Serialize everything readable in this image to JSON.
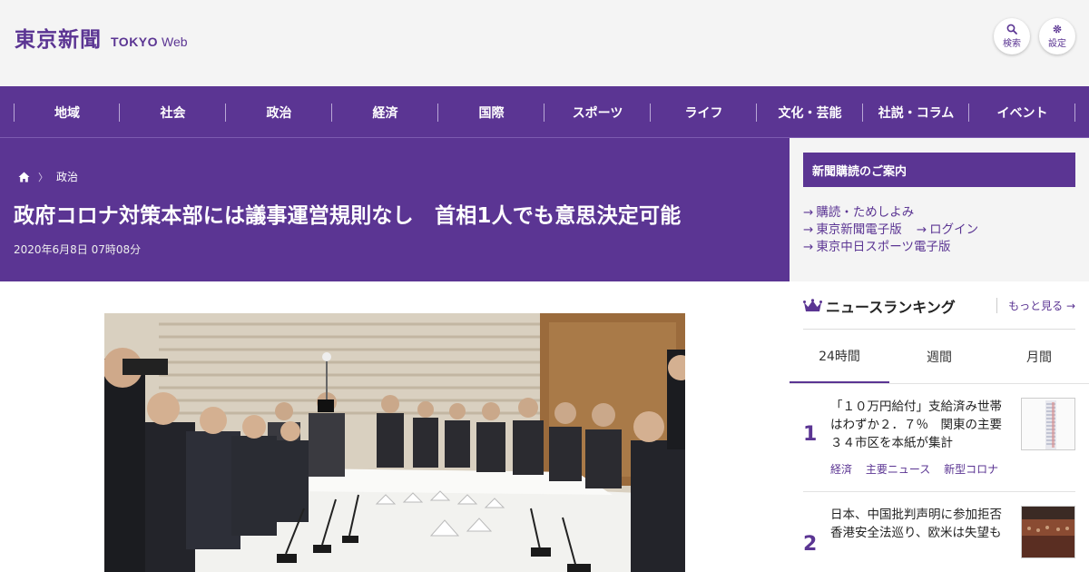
{
  "header": {
    "logo_kanji": "東京新聞",
    "logo_tokyo": "TOKYO",
    "logo_web": "Web",
    "search_label": "検索",
    "settings_label": "設定"
  },
  "nav": {
    "items": [
      "地域",
      "社会",
      "政治",
      "経済",
      "国際",
      "スポーツ",
      "ライフ",
      "文化・芸能",
      "社説・コラム",
      "イベント"
    ]
  },
  "article": {
    "breadcrumb_section": "政治",
    "headline": "政府コロナ対策本部には議事運営規則なし　首相1人でも意思決定可能",
    "date": "2020年6月8日 07時08分"
  },
  "sidebar": {
    "subscribe_title": "新聞購読のご案内",
    "links": {
      "trial": "購読・ためしよみ",
      "digital": "東京新聞電子版",
      "login": "ログイン",
      "chunichi_sports": "東京中日スポーツ電子版"
    },
    "arrow": "→"
  },
  "ranking": {
    "title": "ニュースランキング",
    "more": "もっと見る",
    "tabs": [
      "24時間",
      "週間",
      "月間"
    ],
    "active_tab": 0,
    "items": [
      {
        "rank": "1",
        "title": "「１０万円給付」支給済み世帯はわずか２．７％　関東の主要３４市区を本紙が集計",
        "tags": [
          "経済",
          "主要ニュース",
          "新型コロナ"
        ]
      },
      {
        "rank": "2",
        "title": "日本、中国批判声明に参加拒否　香港安全法巡り、欧米は失望も",
        "tags": []
      }
    ]
  },
  "colors": {
    "brand_purple": "#5b3593",
    "background": "#f4f4f4"
  }
}
